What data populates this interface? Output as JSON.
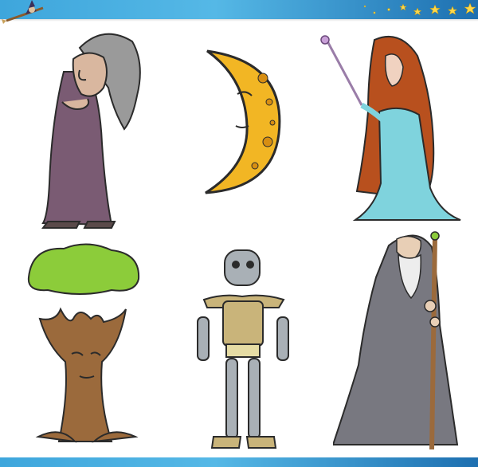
{
  "banner": {
    "colors": {
      "light_blue": "#55b8e6",
      "deep_blue": "#1d6fb0"
    },
    "corner_icon": "witch-on-broom-icon",
    "decoration": "stars-icon"
  },
  "illustrations": [
    {
      "name": "old-witch",
      "colors": {
        "robe": "#7a5b73",
        "hair": "#9a9a9a",
        "skin": "#d9b79f"
      }
    },
    {
      "name": "crescent-moon-face",
      "colors": {
        "moon": "#f2b624",
        "outline": "#2b2b2b"
      }
    },
    {
      "name": "fairy-princess",
      "colors": {
        "dress": "#7fd3dd",
        "hair": "#b8501e",
        "wand": "#c9a0d8"
      }
    },
    {
      "name": "tree-ent",
      "colors": {
        "leaves": "#8ccc3a",
        "bark": "#9b6a3c"
      }
    },
    {
      "name": "robot",
      "colors": {
        "metal": "#a9b0b6",
        "gold": "#c9b47a"
      }
    },
    {
      "name": "old-wizard",
      "colors": {
        "robe": "#787880",
        "beard": "#ededed",
        "staff": "#9b6a3c"
      }
    }
  ]
}
